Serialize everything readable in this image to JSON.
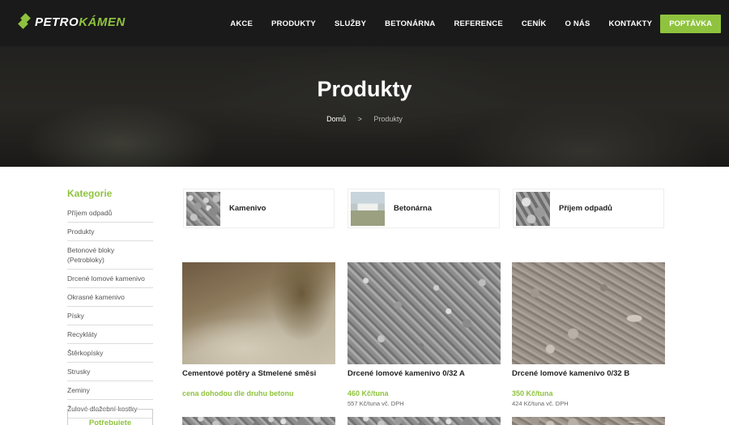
{
  "header": {
    "logo": {
      "part1": "PETRO",
      "part2": "KÁMEN"
    },
    "nav": [
      "AKCE",
      "PRODUKTY",
      "SLUŽBY",
      "BETONÁRNA",
      "REFERENCE",
      "CENÍK",
      "O NÁS",
      "KONTAKTY"
    ],
    "cta": "POPTÁVKA"
  },
  "hero": {
    "title": "Produkty",
    "breadcrumb": {
      "home": "Domů",
      "separator": ">",
      "current": "Produkty"
    }
  },
  "sidebar": {
    "title": "Kategorie",
    "items": [
      "Příjem odpadů",
      "Produkty",
      "Betonové bloky (Petrobloky)",
      "Drcené lomové kamenivo",
      "Okrasné kamenivo",
      "Písky",
      "Recykláty",
      "Štěrkopísky",
      "Strusky",
      "Zeminy",
      "Žulové dlažební kostky"
    ],
    "box_label": "Potřebujete"
  },
  "categories": [
    {
      "label": "Kamenivo",
      "icon": "gravel-thumb"
    },
    {
      "label": "Betonárna",
      "icon": "concrete-plant-thumb"
    },
    {
      "label": "Příjem odpadů",
      "icon": "waste-thumb"
    }
  ],
  "products": [
    {
      "name": "Cementové potěry a Stmelené směsi",
      "price": "cena dohodou dle druhu betonu",
      "sub": ""
    },
    {
      "name": "Drcené lomové kamenivo 0/32 A",
      "price": "460 Kč/tuna",
      "sub": "557 Kč/tuna vč. DPH"
    },
    {
      "name": "Drcené lomové kamenivo 0/32 B",
      "price": "350 Kč/tuna",
      "sub": "424 Kč/tuna vč. DPH"
    }
  ],
  "colors": {
    "accent": "#8fc33e",
    "header_bg": "#1a1a1a"
  }
}
